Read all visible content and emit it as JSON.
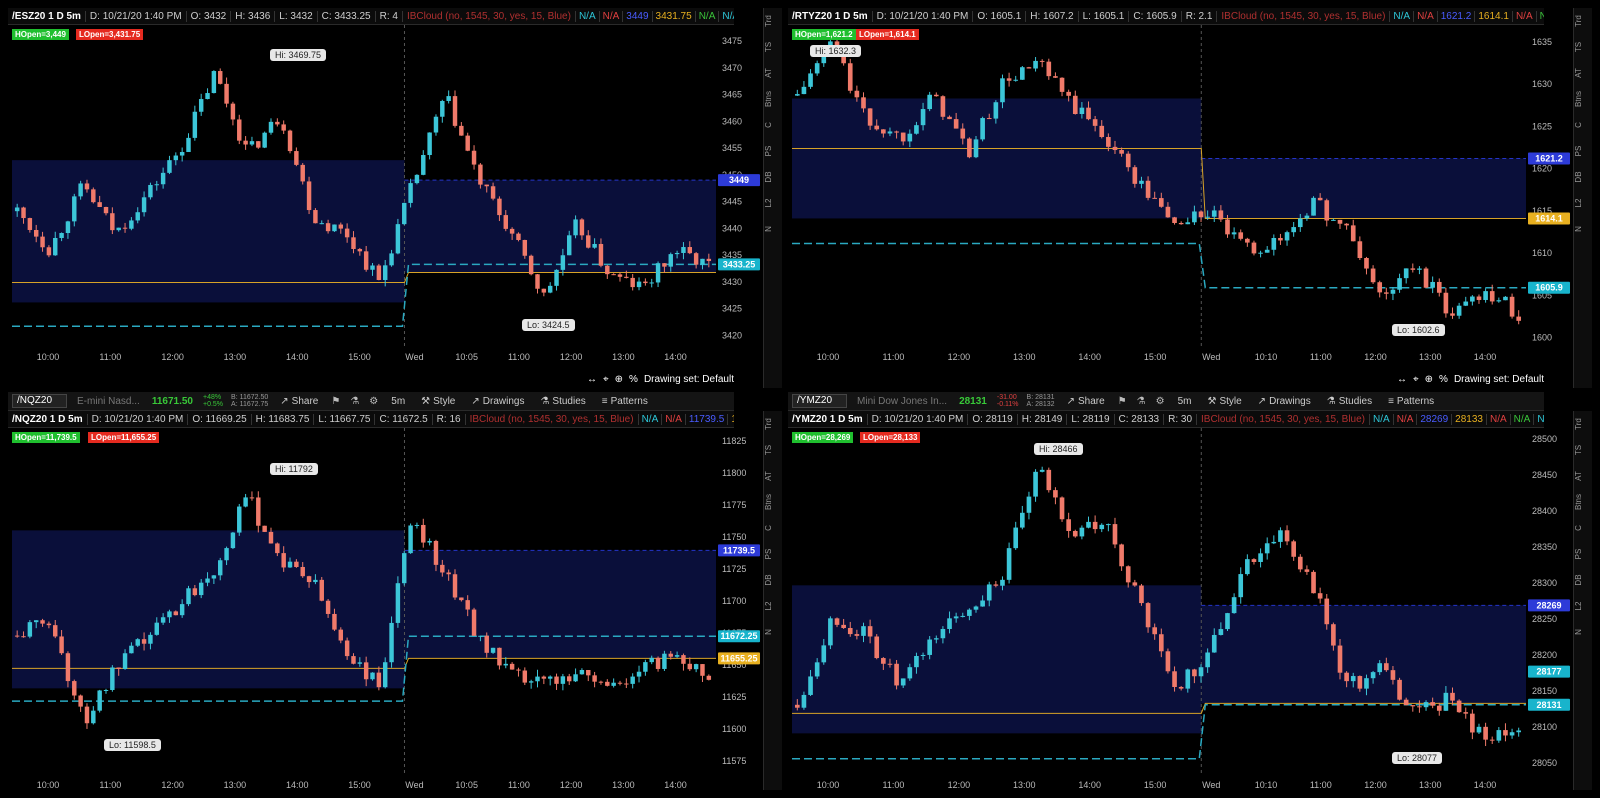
{
  "charts": [
    {
      "symbol_label": "/ESZ20 1 D 5m",
      "header": [
        "D: 10/21/20 1:40 PM",
        "O: 3432",
        "H: 3436",
        "L: 3432",
        "C: 3433.25",
        "R: 4"
      ],
      "cloud": "IBCloud (no, 1545, 30, yes, 15, Blue)",
      "header_flags": [
        {
          "t": "N/A",
          "c": "na1"
        },
        {
          "t": "N/A",
          "c": "na2"
        },
        {
          "t": "3449",
          "c": "blu"
        },
        {
          "t": "3431.75",
          "c": "gold"
        },
        {
          "t": "N/A",
          "c": "na3"
        },
        {
          "t": "N/A",
          "c": "na1"
        }
      ],
      "toolbar": null,
      "hopen": "HOpen=3,449",
      "lopen": "LOpen=3,431.75",
      "hi_label": "Hi: 3469.75",
      "lo_label": "Lo: 3424.5",
      "y_ticks": [
        "3475",
        "3470",
        "3465",
        "3460",
        "3455",
        "3450",
        "3445",
        "3440",
        "3435",
        "3430",
        "3425",
        "3420"
      ],
      "x_ticks": [
        "10:00",
        "11:00",
        "12:00",
        "13:00",
        "14:00",
        "15:00",
        "Wed",
        "10:05",
        "11:00",
        "12:00",
        "13:00",
        "14:00"
      ],
      "price_badges": [
        {
          "t": "3449",
          "c": "#2d3bd8"
        },
        {
          "t": "3433.25",
          "c": "#18b4cc"
        }
      ],
      "footer": {
        "drawing_set": "Drawing set: Default"
      },
      "chart_data": {
        "type": "candlestick",
        "ylim": [
          3418,
          3478
        ],
        "hi": 3469.75,
        "lo": 3424.5,
        "hopen": 3449,
        "lopen": 3431.75,
        "last": 3433.25
      }
    },
    {
      "symbol_label": "/RTYZ20 1 D 5m",
      "header": [
        "D: 10/21/20 1:40 PM",
        "O: 1605.1",
        "H: 1607.2",
        "L: 1605.1",
        "C: 1605.9",
        "R: 2.1"
      ],
      "cloud": "IBCloud (no, 1545, 30, yes, 15, Blue)",
      "header_flags": [
        {
          "t": "N/A",
          "c": "na1"
        },
        {
          "t": "N/A",
          "c": "na2"
        },
        {
          "t": "1621.2",
          "c": "blu"
        },
        {
          "t": "1614.1",
          "c": "gold"
        },
        {
          "t": "N/A",
          "c": "na2"
        },
        {
          "t": "N/A",
          "c": "na3"
        },
        {
          "t": "N/A",
          "c": "na1"
        }
      ],
      "toolbar": null,
      "hopen": "HOpen=1,621.2",
      "lopen": "LOpen=1,614.1",
      "hi_label": "Hi: 1632.3",
      "lo_label": "Lo: 1602.6",
      "y_ticks": [
        "1635",
        "1630",
        "1625",
        "1620",
        "1615",
        "1610",
        "1605",
        "1600"
      ],
      "x_ticks": [
        "10:00",
        "11:00",
        "12:00",
        "13:00",
        "14:00",
        "15:00",
        "Wed",
        "10:10",
        "11:00",
        "12:00",
        "13:00",
        "14:00"
      ],
      "price_badges": [
        {
          "t": "1621.2",
          "c": "#2d3bd8"
        },
        {
          "t": "1614.1",
          "c": "#e8b020"
        },
        {
          "t": "1605.9",
          "c": "#18b4cc"
        }
      ],
      "footer": {
        "drawing_set": "Drawing set: Default"
      },
      "chart_data": {
        "type": "candlestick",
        "ylim": [
          1599,
          1637
        ],
        "hi": 1632.3,
        "lo": 1602.6,
        "hopen": 1621.2,
        "lopen": 1614.1,
        "last": 1605.9
      }
    },
    {
      "symbol_label": "/NQZ20 1 D 5m",
      "header": [
        "D: 10/21/20 1:40 PM",
        "O: 11669.25",
        "H: 11683.75",
        "L: 11667.75",
        "C: 11672.5",
        "R: 16"
      ],
      "cloud": "IBCloud (no, 1545, 30, yes, 15, Blue)",
      "header_flags": [
        {
          "t": "N/A",
          "c": "na1"
        },
        {
          "t": "N/A",
          "c": "na2"
        },
        {
          "t": "11739.5",
          "c": "blu"
        },
        {
          "t": "11655.25",
          "c": "gold"
        }
      ],
      "toolbar": {
        "symbol": "/NQZ20",
        "description": "E-mini Nasd...",
        "last": "11671.50",
        "chg1": "+48%",
        "chg2": "+0.5%",
        "bs1": "B: 11672.50",
        "bs2": "A: 11672.75",
        "interval": "5m",
        "share": "Share",
        "style": "Style",
        "drawings": "Drawings",
        "studies": "Studies",
        "patterns": "Patterns"
      },
      "hopen": "HOpen=11,739.5",
      "lopen": "LOpen=11,655.25",
      "hi_label": "Hi: 11792",
      "lo_label": "Lo: 11598.5",
      "y_ticks": [
        "11825",
        "11800",
        "11775",
        "11750",
        "11725",
        "11700",
        "11675",
        "11650",
        "11625",
        "11600",
        "11575"
      ],
      "x_ticks": [
        "10:00",
        "11:00",
        "12:00",
        "13:00",
        "14:00",
        "15:00",
        "Wed",
        "10:05",
        "11:00",
        "12:00",
        "13:00",
        "14:00"
      ],
      "price_badges": [
        {
          "t": "11739.5",
          "c": "#2d3bd8"
        },
        {
          "t": "11672.25",
          "c": "#18b4cc"
        },
        {
          "t": "11655.25",
          "c": "#e8b020"
        }
      ],
      "footer": null,
      "chart_data": {
        "type": "candlestick",
        "ylim": [
          11565,
          11835
        ],
        "hi": 11792,
        "lo": 11598.5,
        "hopen": 11739.5,
        "lopen": 11655.25,
        "last": 11672.5
      }
    },
    {
      "symbol_label": "/YMZ20 1 D 5m",
      "header": [
        "D: 10/21/20 1:40 PM",
        "O: 28119",
        "H: 28149",
        "L: 28119",
        "C: 28133",
        "R: 30"
      ],
      "cloud": "IBCloud (no, 1545, 30, yes, 15, Blue)",
      "header_flags": [
        {
          "t": "N/A",
          "c": "na1"
        },
        {
          "t": "N/A",
          "c": "na2"
        },
        {
          "t": "28269",
          "c": "blu"
        },
        {
          "t": "28133",
          "c": "gold"
        },
        {
          "t": "N/A",
          "c": "na2"
        },
        {
          "t": "N/A",
          "c": "na3"
        },
        {
          "t": "N/A",
          "c": "na1"
        }
      ],
      "toolbar": {
        "symbol": "/YMZ20",
        "description": "Mini Dow Jones In...",
        "last": "28131",
        "chg1": "-31.00",
        "chg2": "-0.11%",
        "bs1": "B: 28131",
        "bs2": "A: 28132",
        "interval": "5m",
        "share": "Share",
        "style": "Style",
        "drawings": "Drawings",
        "studies": "Studies",
        "patterns": "Patterns"
      },
      "hopen": "HOpen=28,269",
      "lopen": "LOpen=28,133",
      "hi_label": "Hi: 28466",
      "lo_label": "Lo: 28077",
      "y_ticks": [
        "28500",
        "28450",
        "28400",
        "28350",
        "28300",
        "28250",
        "28200",
        "28150",
        "28100",
        "28050"
      ],
      "x_ticks": [
        "10:00",
        "11:00",
        "12:00",
        "13:00",
        "14:00",
        "15:00",
        "Wed",
        "10:10",
        "11:00",
        "12:00",
        "13:00",
        "14:00"
      ],
      "price_badges": [
        {
          "t": "28269",
          "c": "#2d3bd8"
        },
        {
          "t": "28177",
          "c": "#18b4cc"
        },
        {
          "t": "28131",
          "c": "#18b4cc"
        }
      ],
      "footer": null,
      "chart_data": {
        "type": "candlestick",
        "ylim": [
          28035,
          28515
        ],
        "hi": 28466,
        "lo": 28077,
        "hopen": 28269,
        "lopen": 28133,
        "last": 28131
      }
    }
  ],
  "side_tabs": [
    "Trd",
    "TS",
    "AT",
    "Btns",
    "C",
    "PS",
    "DB",
    "L2",
    "N"
  ],
  "colors": {
    "up": "#3cc6d8",
    "down": "#f07a6a",
    "hopen_badge": "#1fbf2e",
    "lopen_badge": "#e52a1f",
    "cloud": "#0a0f3a",
    "gold": "#d7a227",
    "teal": "#2aa9c1"
  }
}
